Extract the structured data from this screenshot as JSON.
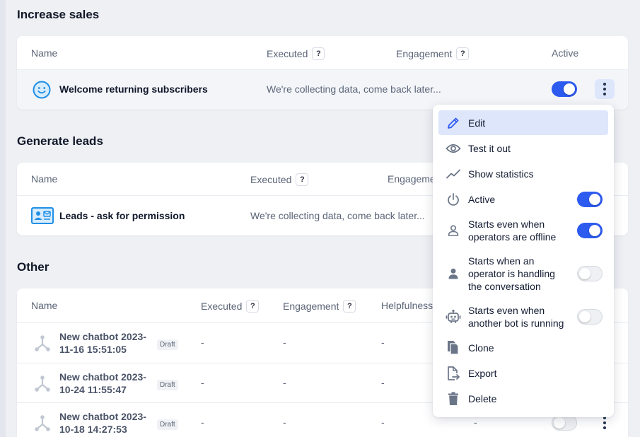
{
  "sections": {
    "increase_sales": {
      "title": "Increase sales",
      "columns": {
        "name": "Name",
        "executed": "Executed",
        "engagement": "Engagement",
        "active": "Active"
      },
      "row": {
        "name": "Welcome returning subscribers",
        "status": "We're collecting data, come back later...",
        "active": true
      }
    },
    "generate_leads": {
      "title": "Generate leads",
      "columns": {
        "name": "Name",
        "executed": "Executed",
        "engagement": "Engagement"
      },
      "row": {
        "name": "Leads - ask for permission",
        "status": "We're collecting data, come back later..."
      }
    },
    "other": {
      "title": "Other",
      "columns": {
        "name": "Name",
        "executed": "Executed",
        "engagement": "Engagement",
        "helpfulness": "Helpfulness"
      },
      "rows": [
        {
          "name": "New chatbot 2023-11-16 15:51:05",
          "badge": "Draft",
          "executed": "-",
          "engagement": "-",
          "helpfulness": "-"
        },
        {
          "name": "New chatbot 2023-10-24 11:55:47",
          "badge": "Draft",
          "executed": "-",
          "engagement": "-",
          "helpfulness": "-"
        },
        {
          "name": "New chatbot 2023-10-18 14:27:53",
          "badge": "Draft",
          "executed": "-",
          "engagement": "-",
          "helpfulness": "-",
          "extra": "-"
        }
      ]
    }
  },
  "help_badge": "?",
  "menu": {
    "items": [
      {
        "label": "Edit",
        "icon": "pencil-icon",
        "selected": true
      },
      {
        "label": "Test it out",
        "icon": "eye-icon"
      },
      {
        "label": "Show statistics",
        "icon": "chart-line-icon"
      },
      {
        "label": "Active",
        "icon": "power-icon",
        "toggle": true
      },
      {
        "label": "Starts even when operators are offline",
        "icon": "user-outline-icon",
        "toggle": true
      },
      {
        "label": "Starts when an operator is handling the conversation",
        "icon": "user-filled-icon",
        "toggle": false
      },
      {
        "label": "Starts even when another bot is running",
        "icon": "robot-icon",
        "toggle": false
      },
      {
        "label": "Clone",
        "icon": "copy-icon"
      },
      {
        "label": "Export",
        "icon": "export-icon"
      },
      {
        "label": "Delete",
        "icon": "trash-icon"
      }
    ]
  },
  "colors": {
    "accent": "#2d5bf0",
    "selected_bg": "#dde6fb",
    "icon_gray": "#6b7588",
    "smile_blue": "#1f8fe6"
  }
}
